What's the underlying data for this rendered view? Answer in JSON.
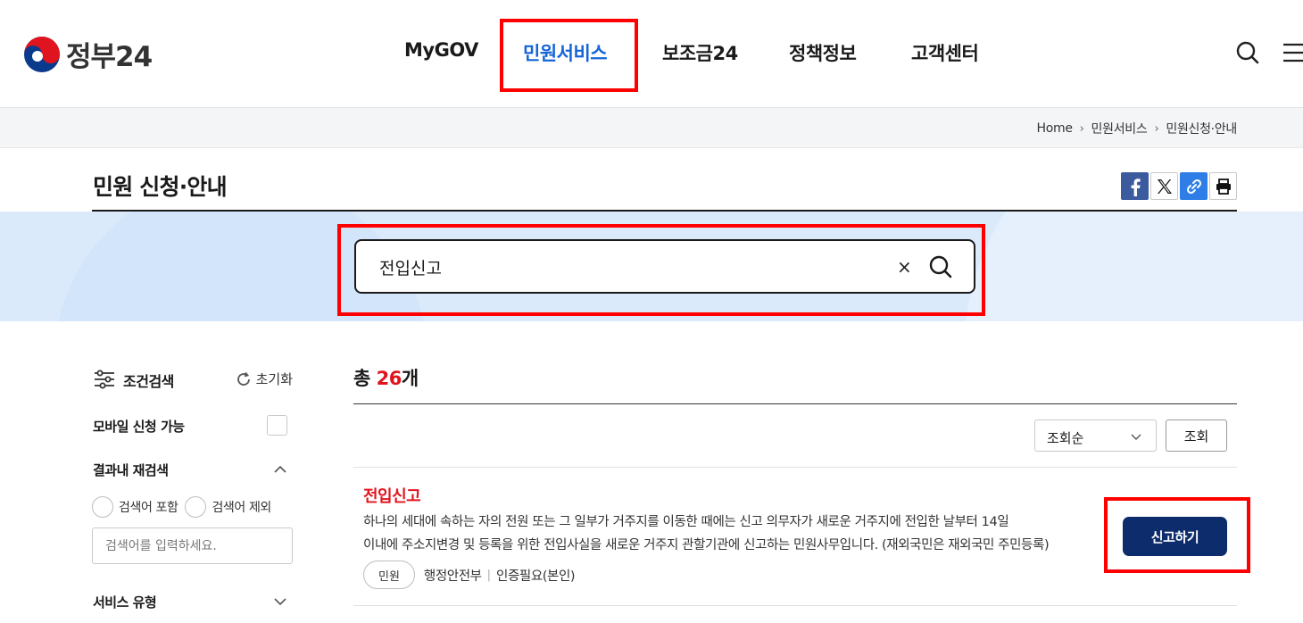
{
  "header": {
    "logo_text": "정부24",
    "nav": [
      "MyGOV",
      "민원서비스",
      "보조금24",
      "정책정보",
      "고객센터"
    ],
    "active_nav": "민원서비스"
  },
  "breadcrumb": [
    "Home",
    "민원서비스",
    "민원신청·안내"
  ],
  "page": {
    "title": "민원 신청·안내"
  },
  "search": {
    "value": "전입신고",
    "clear_symbol": "×"
  },
  "filter": {
    "title": "조건검색",
    "reset_label": "초기화",
    "mobile_label": "모바일 신청 가능",
    "refine_label": "결과내 재검색",
    "include_label": "검색어 포함",
    "exclude_label": "검색어 제외",
    "input_placeholder": "검색어를 입력하세요.",
    "service_type_label": "서비스 유형"
  },
  "results": {
    "total_prefix": "총 ",
    "total_count": "26",
    "total_suffix": "개",
    "sort_value": "조회순",
    "view_button": "조회",
    "items": [
      {
        "title": "전입신고",
        "desc_line1": "하나의 세대에 속하는 자의 전원 또는 그 일부가 거주지를 이동한 때에는 신고 의무자가 새로운 거주지에 전입한 날부터 14일",
        "desc_line2": "이내에 주소지변경 및 등록을 위한 전입사실을 새로운 거주지 관할기관에 신고하는 민원사무입니다. (재외국민은 재외국민 주민등록)",
        "tag": "민원",
        "agency": "행정안전부",
        "auth": "인증필요(본인)",
        "action": "신고하기"
      }
    ]
  },
  "colors": {
    "accent_blue": "#1565d8",
    "count_red": "#e0141e",
    "navy_button": "#0d2c6b",
    "highlight_red": "#ff0000",
    "search_band": "#dbeafb"
  },
  "icons": [
    "taegeuk-logo-icon",
    "search-icon",
    "menu-icon",
    "facebook-icon",
    "x-icon",
    "link-icon",
    "print-icon",
    "filter-sliders-icon",
    "refresh-icon",
    "chevron-up-icon",
    "chevron-down-icon",
    "close-icon"
  ]
}
